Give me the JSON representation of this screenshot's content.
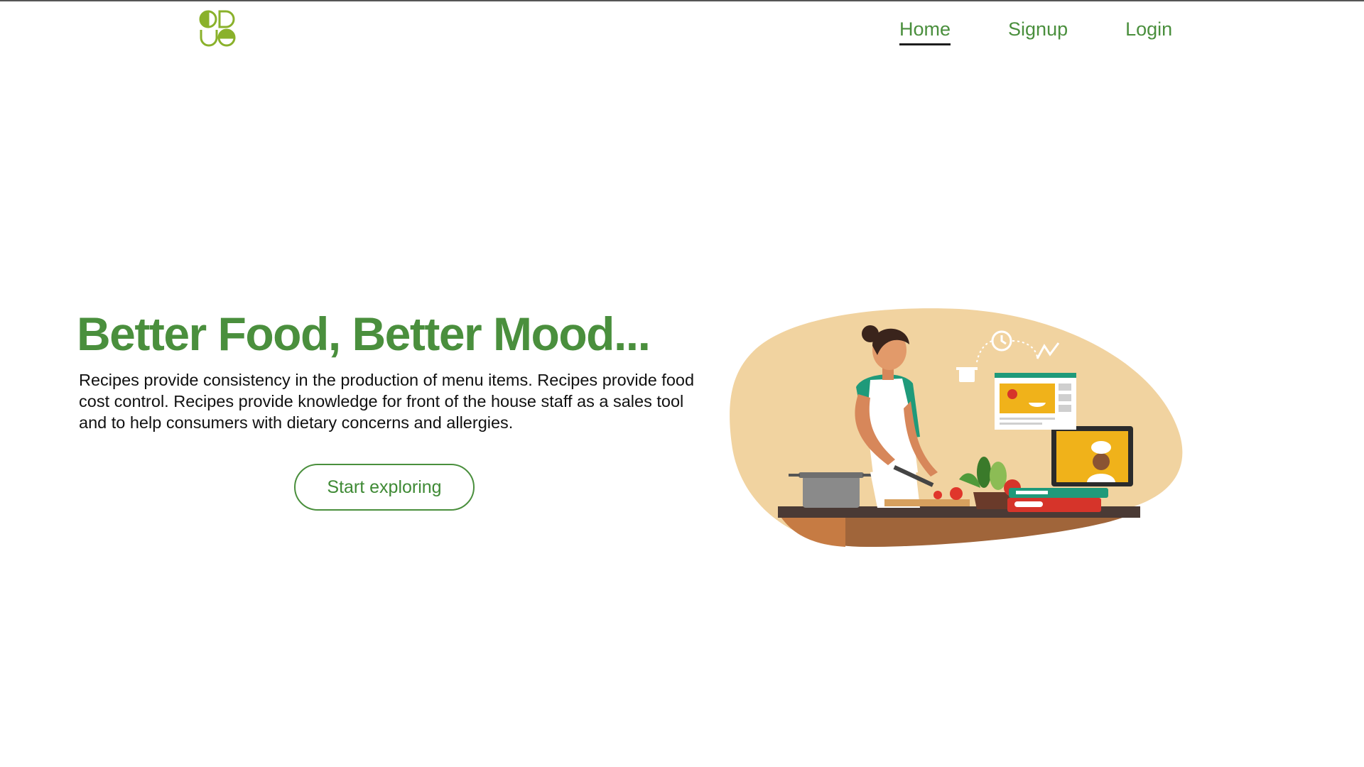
{
  "header": {
    "logo_name": "leaf-clover-logo",
    "nav": [
      {
        "label": "Home",
        "active": true
      },
      {
        "label": "Signup",
        "active": false
      },
      {
        "label": "Login",
        "active": false
      }
    ]
  },
  "hero": {
    "title": "Better Food, Better Mood...",
    "description": "Recipes provide consistency in the production of menu items. Recipes provide food cost control. Recipes provide knowledge for front of the house staff as a sales tool and to help consumers with dietary concerns and allergies.",
    "cta_label": "Start exploring",
    "illustration": "woman-cooking-with-online-recipe-illustration"
  },
  "colors": {
    "brand_green": "#4a8f3d",
    "logo_green": "#8ab12b",
    "blob_beige": "#f1d3a0",
    "text_dark": "#111111"
  }
}
